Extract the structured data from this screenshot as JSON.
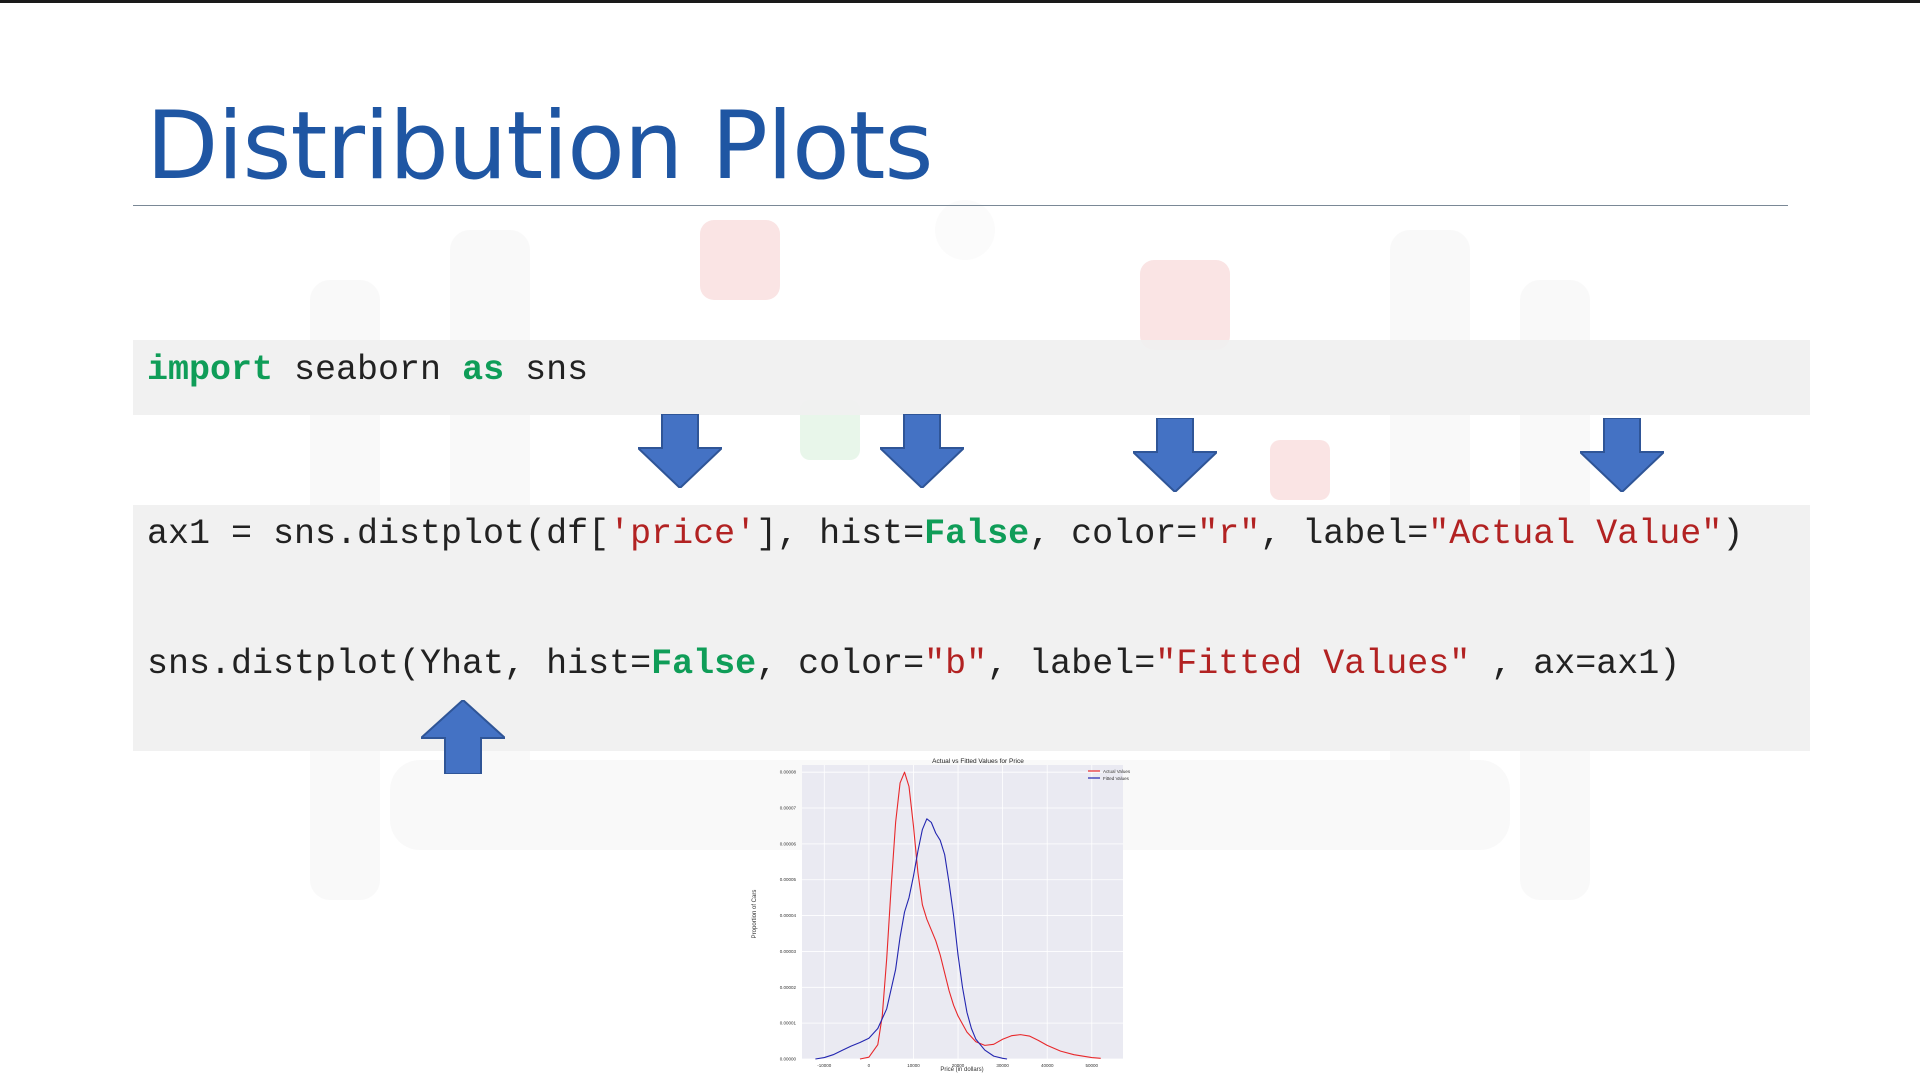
{
  "slide": {
    "title": "Distribution Plots"
  },
  "code": {
    "line1": {
      "kw_import": "import",
      "t1": " seaborn ",
      "kw_as": "as",
      "t2": " sns"
    },
    "line2": {
      "t1": "ax1 = sns.distplot(df[",
      "s1": "'price'",
      "t2": "], hist=",
      "kw1": "False",
      "t3": ", color=",
      "s2": "\"r\"",
      "t4": ", label=",
      "s3": "\"Actual Value\"",
      "t5": ")"
    },
    "line3": {
      "t1": "sns.distplot(Yhat, hist=",
      "kw1": "False",
      "t2": ", color=",
      "s1": "\"b\"",
      "t3": ", label=",
      "s2": "\"Fitted Values\"",
      "t4": " , ax=ax1)"
    }
  },
  "arrow_color": "#4472c4",
  "chart_data": {
    "type": "line",
    "title": "Actual vs Fitted Values for Price",
    "xlabel": "Price (in dollars)",
    "ylabel": "Proportion of Cars",
    "xlim": [
      -15000,
      57000
    ],
    "ylim": [
      0,
      8.2e-05
    ],
    "xticks": [
      -10000,
      0,
      10000,
      20000,
      30000,
      40000,
      50000
    ],
    "xtick_labels": [
      "-10000",
      "0",
      "10000",
      "20000",
      "30000",
      "40000",
      "50000"
    ],
    "yticks": [
      0,
      1e-05,
      2e-05,
      3e-05,
      4e-05,
      5e-05,
      6e-05,
      7e-05,
      8e-05
    ],
    "ytick_labels": [
      "0.00000",
      "0.00001",
      "0.00002",
      "0.00003",
      "0.00004",
      "0.00005",
      "0.00006",
      "0.00007",
      "0.00008"
    ],
    "grid": true,
    "legend_position": "top-right",
    "series": [
      {
        "name": "Actual Values",
        "color": "#e8282b",
        "x": [
          -2000,
          0,
          2000,
          3000,
          4000,
          5000,
          6000,
          7000,
          8000,
          9000,
          10000,
          11000,
          12000,
          13000,
          14000,
          15000,
          16000,
          17000,
          18000,
          19000,
          20000,
          22000,
          24000,
          26000,
          28000,
          30000,
          32000,
          34000,
          36000,
          38000,
          40000,
          43000,
          46000,
          50000,
          52000
        ],
        "y": [
          0.0,
          5e-07,
          4e-06,
          1.2e-05,
          2.8e-05,
          4.8e-05,
          6.6e-05,
          7.7e-05,
          8e-05,
          7.6e-05,
          6.5e-05,
          5.2e-05,
          4.3e-05,
          3.9e-05,
          3.6e-05,
          3.3e-05,
          2.9e-05,
          2.4e-05,
          1.9e-05,
          1.5e-05,
          1.2e-05,
          7.5e-06,
          4.8e-06,
          3.8e-06,
          4.1e-06,
          5.5e-06,
          6.5e-06,
          6.8e-06,
          6.4e-06,
          5.2e-06,
          3.8e-06,
          2.2e-06,
          1.2e-06,
          4e-07,
          2e-07
        ]
      },
      {
        "name": "Fitted Values",
        "color": "#2326b0",
        "x": [
          -12000,
          -10000,
          -8000,
          -6000,
          -4000,
          -2000,
          0,
          2000,
          4000,
          6000,
          7000,
          8000,
          9000,
          10000,
          11000,
          12000,
          13000,
          14000,
          15000,
          16000,
          17000,
          18000,
          19000,
          20000,
          21000,
          22000,
          23000,
          24000,
          26000,
          28000,
          30000,
          31000
        ],
        "y": [
          0.0,
          4e-07,
          1.2e-06,
          2.4e-06,
          3.6e-06,
          4.6e-06,
          5.8e-06,
          8.5e-06,
          1.4e-05,
          2.5e-05,
          3.4e-05,
          4.1e-05,
          4.5e-05,
          5.1e-05,
          5.8e-05,
          6.4e-05,
          6.7e-05,
          6.6e-05,
          6.3e-05,
          6.1e-05,
          5.7e-05,
          4.9e-05,
          4e-05,
          2.9e-05,
          2e-05,
          1.3e-05,
          8.5e-06,
          5.5e-06,
          2.5e-06,
          8e-07,
          2e-07,
          0.0
        ]
      }
    ]
  }
}
